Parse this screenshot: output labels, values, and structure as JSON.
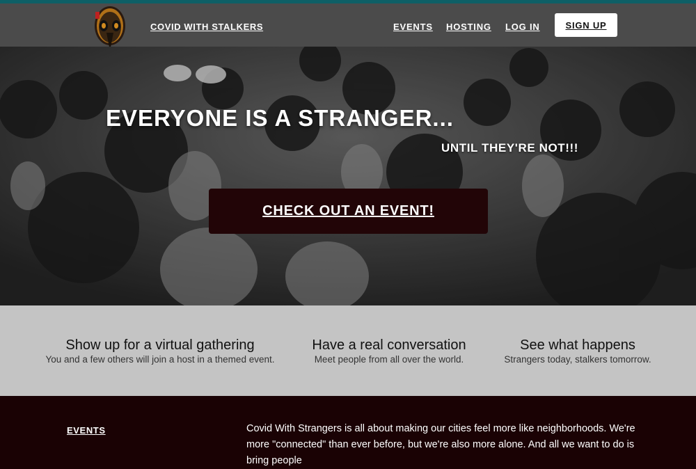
{
  "nav": {
    "brand": "COVID WITH STALKERS",
    "links": [
      "EVENTS",
      "HOSTING",
      "LOG IN"
    ],
    "signup": "SIGN UP"
  },
  "hero": {
    "title": "EVERYONE IS A STRANGER...",
    "subtitle": "UNTIL THEY'RE NOT!!!",
    "cta": "CHECK OUT AN EVENT!"
  },
  "features": [
    {
      "title": "Show up for a virtual gathering",
      "desc": "You and a few others will join a host in a themed event."
    },
    {
      "title": "Have a real conversation",
      "desc": "Meet people from all over the world."
    },
    {
      "title": "See what happens",
      "desc": "Strangers today, stalkers tomorrow."
    }
  ],
  "footer": {
    "link": "EVENTS",
    "text": "Covid With Strangers is all about making our cities feel more like neighborhoods. We're more \"connected\" than ever before, but we're also more alone. And all we want to do is bring people"
  },
  "colors": {
    "accent_bar": "#0e5f66",
    "nav_bg": "#4b4b4b",
    "cta_bg": "#220507",
    "features_bg": "#c4c4c4",
    "footer_bg": "#1a0204"
  }
}
